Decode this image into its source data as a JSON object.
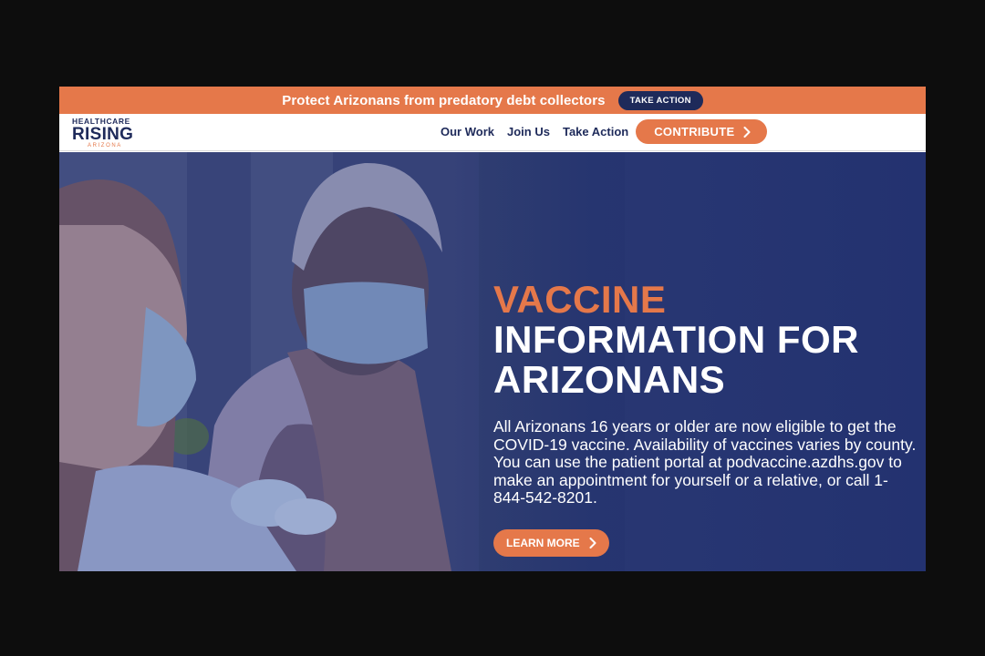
{
  "banner": {
    "text": "Protect Arizonans from predatory debt collectors",
    "button": "TAKE ACTION"
  },
  "logo": {
    "top": "HEALTHCARE",
    "main": "RISING",
    "sub": "ARIZONA"
  },
  "nav": {
    "items": [
      "Our Work",
      "Join Us",
      "Take Action"
    ],
    "contribute": "CONTRIBUTE"
  },
  "hero": {
    "headline_accent": "VACCINE",
    "headline_line2": "INFORMATION FOR",
    "headline_line3": "ARIZONANS",
    "body": "All Arizonans 16 years or older are now eligible to get the COVID-19 vaccine. Availability of vaccines varies by county. You can use the patient portal at podvaccine.azdhs.gov to make an appointment for yourself or a relative, or call 1-844-542-8201.",
    "button": "LEARN MORE"
  },
  "icons": {
    "contribute_chevron": "chevron-right-icon",
    "learn_more_chevron": "chevron-right-icon"
  },
  "colors": {
    "brand_orange": "#e5784a",
    "brand_navy": "#1e2a5a",
    "hero_overlay": "#273670"
  }
}
